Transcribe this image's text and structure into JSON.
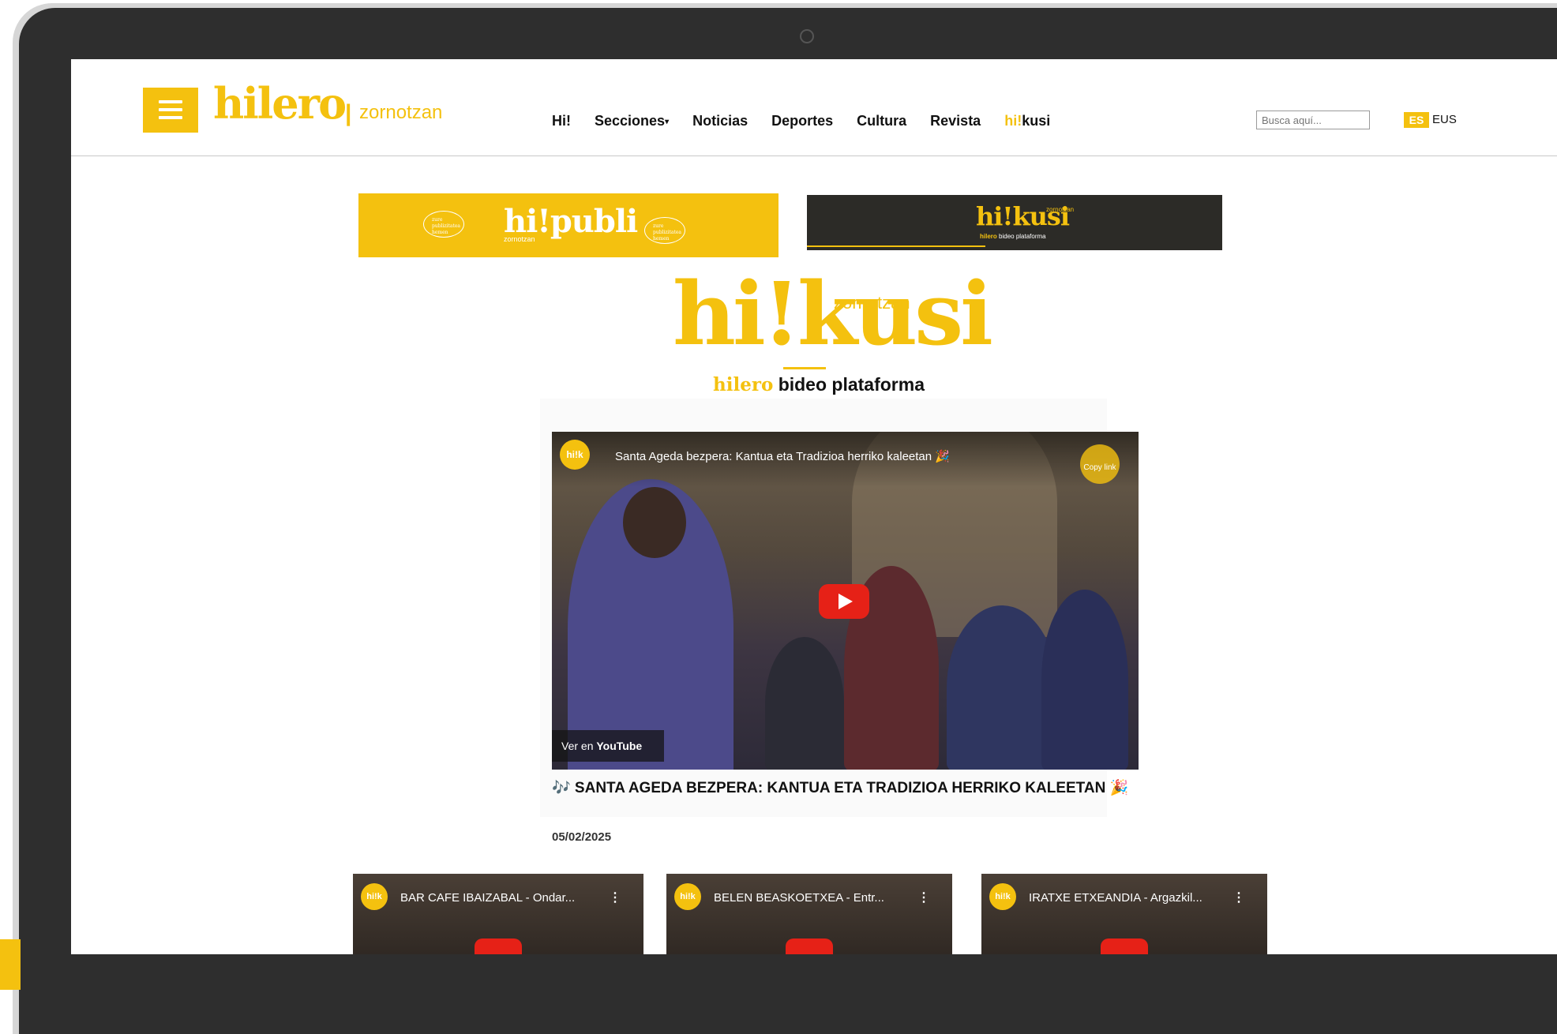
{
  "site": {
    "logo": "hilero",
    "logo_separator": "|",
    "town": "zornotzan"
  },
  "nav": {
    "items": [
      {
        "label": "Hi!"
      },
      {
        "label": "Secciones",
        "caret": "▾"
      },
      {
        "label": "Noticias"
      },
      {
        "label": "Deportes"
      },
      {
        "label": "Cultura"
      },
      {
        "label": "Revista"
      }
    ],
    "kusi_hi": "hi!",
    "kusi_rest": "kusi"
  },
  "search": {
    "placeholder": "Busca aquí..."
  },
  "language": {
    "active": "ES",
    "other": "EUS"
  },
  "banners": {
    "publi": {
      "brand": "hi!publi",
      "town": "zornotzan",
      "bubble_left": "zure publizitatea hemen",
      "bubble_right": "zure publizitatea hemen"
    },
    "kusi": {
      "brand": "hi!kusi",
      "town": "zornotzan",
      "sub_brand": "hilero",
      "sub_rest": "bideo plataforma"
    }
  },
  "hikusi": {
    "logo": "hi!kusi",
    "town": "zornotzan",
    "sub_brand": "hilero",
    "sub_rest": "bideo plataforma"
  },
  "featured_video": {
    "channel_badge": "hi!k",
    "overlay_title": "Santa Ageda bezpera: Kantua eta Tradizioa herriko kaleetan 🎉",
    "copy_label": "Copy link",
    "watch_on": "Ver en",
    "watch_on_brand": "YouTube",
    "heading": "🎶 SANTA AGEDA BEZPERA: KANTUA ETA TRADIZIOA HERRIKO KALEETAN 🎉",
    "date": "05/02/2025"
  },
  "thumbnails": [
    {
      "channel_badge": "hi!k",
      "title": "BAR CAFE IBAIZABAL - Ondar...",
      "menu": "⋮"
    },
    {
      "channel_badge": "hi!k",
      "title": "BELEN BEASKOETXEA - Entr...",
      "menu": "⋮"
    },
    {
      "channel_badge": "hi!k",
      "title": "IRATXE ETXEANDIA - Argazkil...",
      "menu": "⋮"
    }
  ],
  "colors": {
    "brand_yellow": "#f4c10f",
    "bezel": "#2e2e2e",
    "youtube_red": "#e62117"
  }
}
